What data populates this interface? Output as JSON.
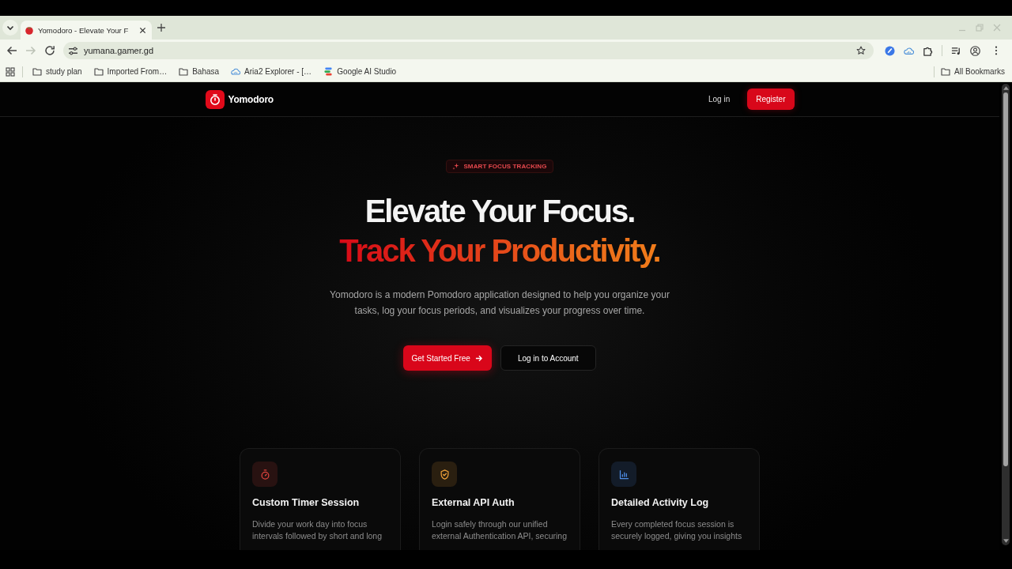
{
  "browser": {
    "tabs": [
      {
        "title": "Yomodoro - Elevate Your F",
        "selected": true
      }
    ],
    "forward_disabled": true,
    "address": "yumana.gamer.gd",
    "bookmarks": [
      {
        "label": "study plan",
        "kind": "folder"
      },
      {
        "label": "Imported From…",
        "kind": "folder"
      },
      {
        "label": "Bahasa",
        "kind": "folder"
      },
      {
        "label": "Aria2 Explorer - […",
        "kind": "cloud"
      },
      {
        "label": "Google AI Studio",
        "kind": "studio"
      }
    ],
    "all_bookmarks": "All Bookmarks"
  },
  "site": {
    "brand": "Yomodoro",
    "nav": [
      {
        "label": "Log in",
        "kind": "link"
      },
      {
        "label": "Register",
        "kind": "primary"
      }
    ]
  },
  "hero": {
    "badge": "SMART FOCUS TRACKING",
    "title": "Elevate Your Focus.",
    "highlight": "Track Your Productivity.",
    "description": "Yomodoro is a modern Pomodoro application designed to help you organize your tasks, log your focus periods, and visualizes your progress over time.",
    "buttons": [
      {
        "label": "Get Started Free",
        "kind": "primary"
      },
      {
        "label": "Log in to Account",
        "kind": "secondary"
      }
    ]
  },
  "features": [
    {
      "kind": "timer",
      "color": "#e0443e",
      "title": "Custom Timer Session",
      "description": "Divide your work day into focus intervals followed by short and long"
    },
    {
      "kind": "shield",
      "color": "#f0a23a",
      "title": "External API Auth",
      "description": "Login safely through our unified external Authentication API, securing"
    },
    {
      "kind": "chart",
      "color": "#4f8fe8",
      "title": "Detailed Activity Log",
      "description": "Every completed focus session is securely logged, giving you insights"
    }
  ]
}
